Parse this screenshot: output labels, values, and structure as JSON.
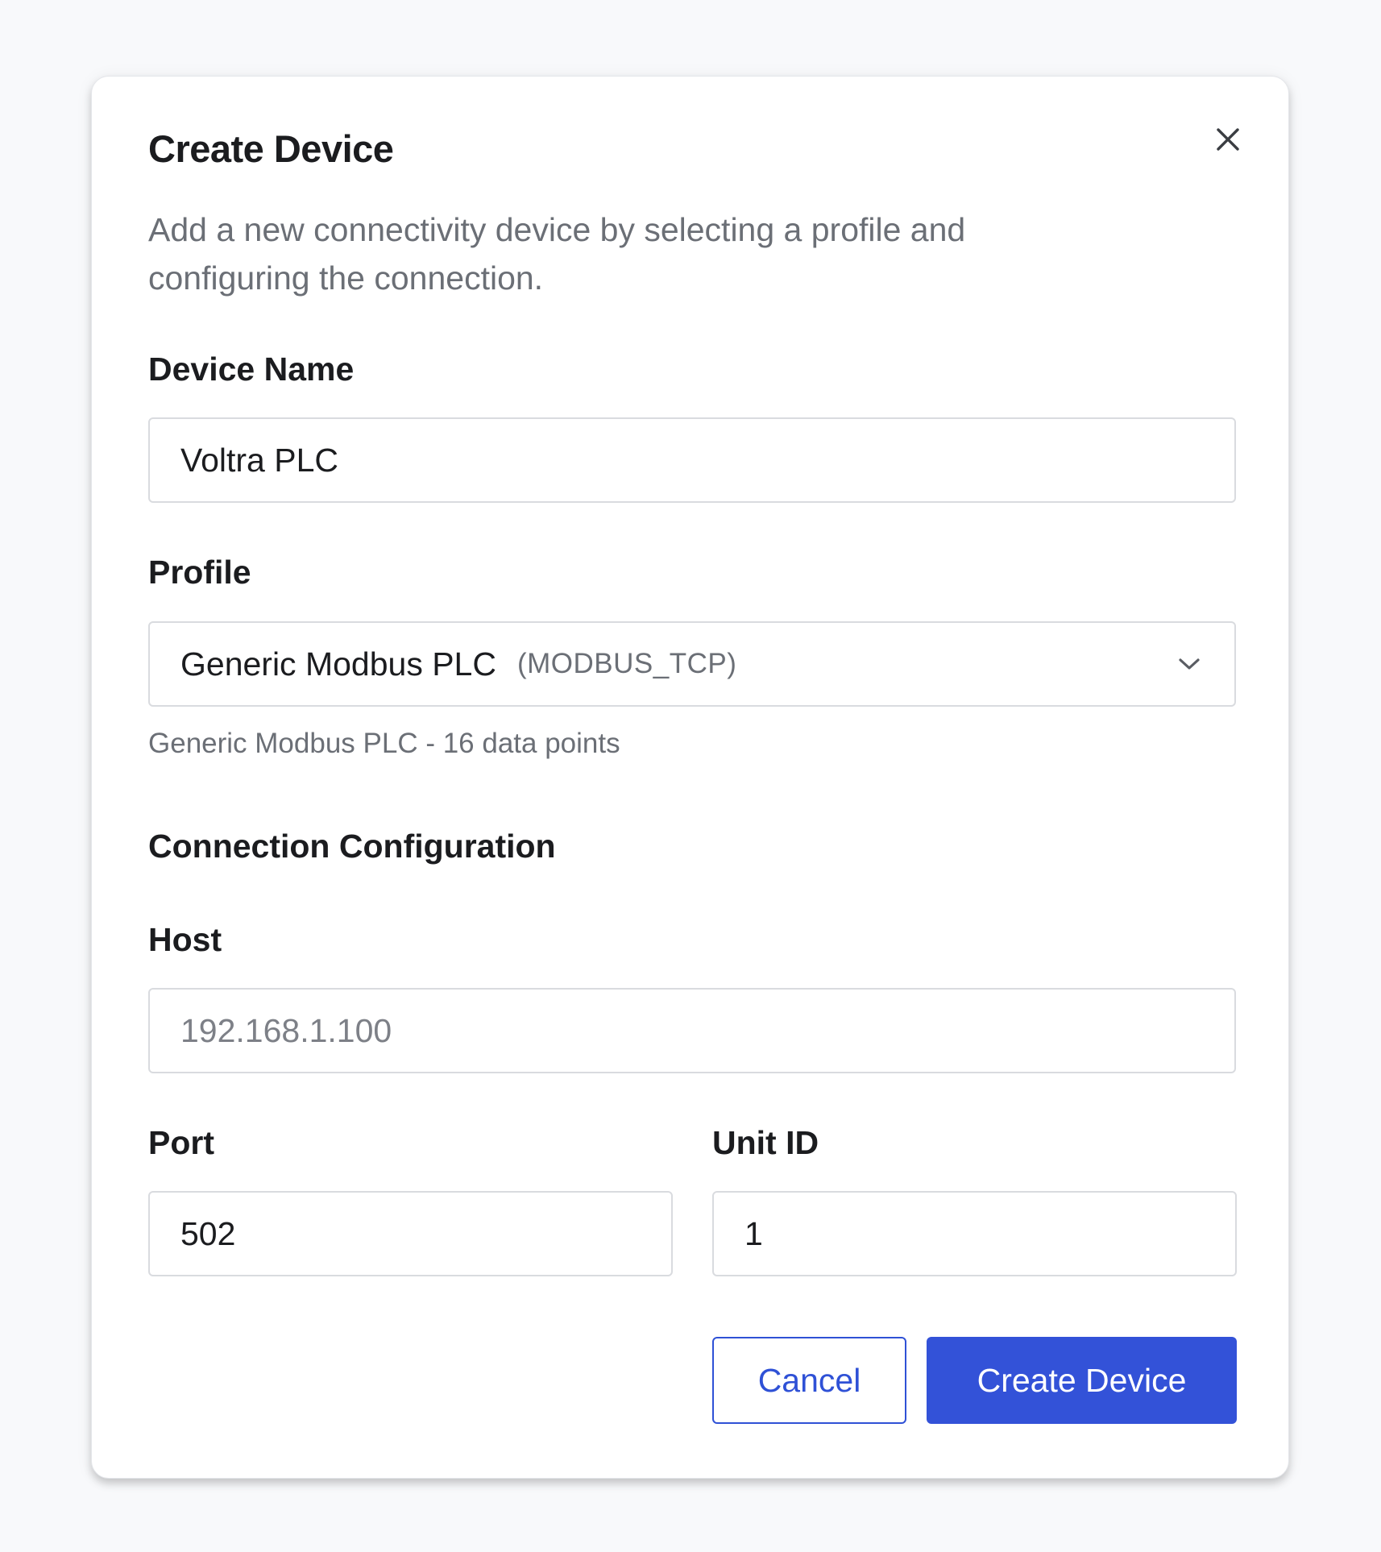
{
  "dialog": {
    "title": "Create Device",
    "description": "Add a new connectivity device by selecting a profile and configuring the connection.",
    "close_icon": "close-icon"
  },
  "fields": {
    "device_name": {
      "label": "Device Name",
      "value": "Voltra PLC"
    },
    "profile": {
      "label": "Profile",
      "selected": "Generic Modbus PLC",
      "protocol": "(MODBUS_TCP)",
      "hint": "Generic Modbus PLC - 16 data points",
      "chevron_icon": "chevron-down-icon"
    },
    "connection": {
      "section_title": "Connection Configuration",
      "host": {
        "label": "Host",
        "value": "",
        "placeholder": "192.168.1.100"
      },
      "port": {
        "label": "Port",
        "value": "502"
      },
      "unit_id": {
        "label": "Unit ID",
        "value": "1"
      }
    }
  },
  "actions": {
    "cancel_label": "Cancel",
    "create_label": "Create Device"
  },
  "colors": {
    "accent": "#3352d8",
    "page_background": "#f8f9fb",
    "muted_text": "#6b6f76"
  }
}
